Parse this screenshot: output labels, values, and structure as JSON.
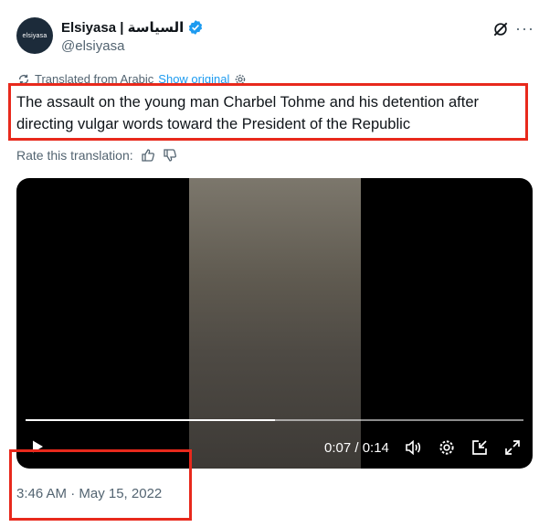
{
  "author": {
    "avatar_text": "elsiyasa",
    "display_name": "Elsiyasa | السياسة",
    "handle": "@elsiyasa",
    "verified_color": "#1d9bf0"
  },
  "header_icons": [
    "grok-icon",
    "more-icon"
  ],
  "more_glyph": "···",
  "translation": {
    "note": "Translated from Arabic",
    "show_original": "Show original"
  },
  "tweet": {
    "text": "The assault on the young man Charbel Tohme and his detention after directing vulgar words toward the President of the Republic"
  },
  "rating": {
    "label": "Rate this translation:"
  },
  "video": {
    "time": "0:07 / 0:14",
    "progress": 0.5
  },
  "timestamp": "3:46 AM · May 15, 2022",
  "colors": {
    "highlight_box": "#e8291c",
    "link": "#1d9bf0",
    "muted": "#536471"
  }
}
